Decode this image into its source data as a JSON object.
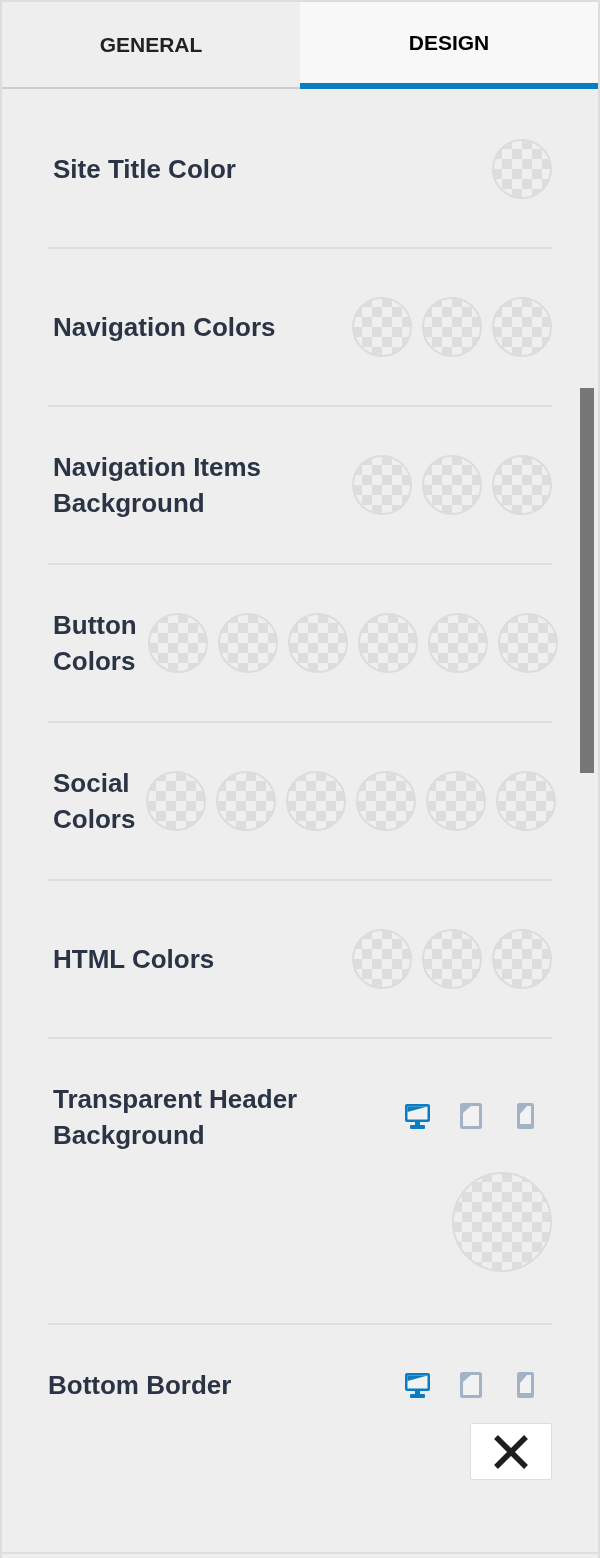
{
  "tabs": [
    {
      "label": "GENERAL",
      "selected": false
    },
    {
      "label": "DESIGN",
      "selected": true
    }
  ],
  "rows": [
    {
      "kind": "colors",
      "label": "Site Title Color",
      "swatches": [
        {
          "kind": "transparent"
        }
      ]
    },
    {
      "kind": "colors",
      "label": "Navigation Colors",
      "swatches": [
        {
          "kind": "transparent"
        },
        {
          "kind": "transparent"
        },
        {
          "kind": "transparent"
        }
      ]
    },
    {
      "kind": "colors",
      "label": "Navigation Items Background",
      "swatches": [
        {
          "kind": "transparent"
        },
        {
          "kind": "transparent"
        },
        {
          "kind": "transparent"
        }
      ]
    },
    {
      "kind": "colors",
      "label": "Button Colors",
      "swatches": [
        {
          "kind": "transparent"
        },
        {
          "kind": "transparent"
        },
        {
          "kind": "transparent"
        },
        {
          "kind": "transparent"
        },
        {
          "kind": "transparent"
        },
        {
          "kind": "transparent"
        }
      ]
    },
    {
      "kind": "colors",
      "label": "Social Colors",
      "swatches": [
        {
          "kind": "transparent"
        },
        {
          "kind": "transparent"
        },
        {
          "kind": "transparent"
        },
        {
          "kind": "transparent"
        },
        {
          "kind": "transparent"
        },
        {
          "kind": "transparent"
        }
      ]
    },
    {
      "kind": "colors",
      "label": "HTML Colors",
      "swatches": [
        {
          "kind": "transparent"
        },
        {
          "kind": "transparent"
        },
        {
          "kind": "transparent"
        }
      ]
    },
    {
      "kind": "responsive_color",
      "label": "Transparent Header Background",
      "devices": [
        {
          "kind": "desktop",
          "selected": true
        },
        {
          "kind": "tablet",
          "selected": false
        },
        {
          "kind": "mobile",
          "selected": false
        }
      ],
      "swatches": [
        {
          "kind": "transparent"
        }
      ]
    },
    {
      "kind": "responsive_border",
      "label": "Bottom Border",
      "devices": [
        {
          "kind": "desktop",
          "selected": true
        },
        {
          "kind": "tablet",
          "selected": false
        },
        {
          "kind": "mobile",
          "selected": false
        }
      ],
      "border_options": [
        {
          "kind": "none"
        }
      ]
    }
  ]
}
